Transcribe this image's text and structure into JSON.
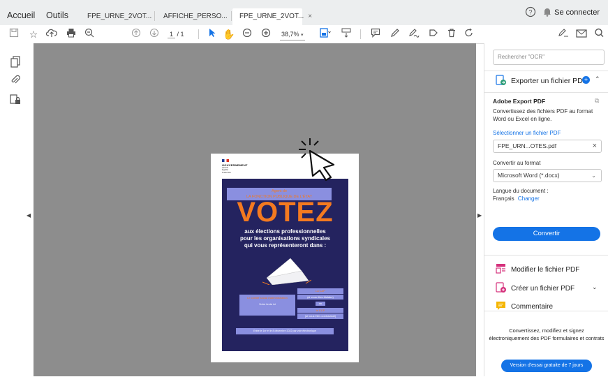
{
  "nav": {
    "home": "Accueil",
    "tools": "Outils"
  },
  "tabs": [
    {
      "label": "FPE_URNE_2VOT..."
    },
    {
      "label": "AFFICHE_PERSO..."
    },
    {
      "label": "FPE_URNE_2VOT...",
      "close": "×"
    }
  ],
  "signin": "Se connecter",
  "toolbar": {
    "page_current": "1",
    "page_total": "/ 1",
    "zoom": "38,7%"
  },
  "poster": {
    "gov_line1": "GOUVERNEMENT",
    "gov_line2": "Liberté",
    "gov_line3": "Égalité",
    "gov_line4": "Fraternité",
    "banner_line1": "Agent de",
    "banner_line2": "LA FONCTION PUBLIQUE DE L'ÉTAT",
    "headline": "VOTEZ",
    "sub1": "aux élections professionnelles",
    "sub2": "pour les organisations syndicales",
    "sub3": "qui vous représenteront dans :",
    "box_left_title": "Le comité social d'administration",
    "box_left_body": "Votre texte ici",
    "cap_title": "La CAP",
    "cap_body": "(si vous êtes titulaire)",
    "ou": "ou",
    "ccp_title": "la CCP",
    "ccp_body": "(si vous êtes contractuel)",
    "footer": "Entre le 1er et le 8 décembre 2022 par voie électronique"
  },
  "panel": {
    "search_placeholder": "Rechercher \"OCR\"",
    "export_label": "Exporter un fichier PDF",
    "section_title": "Adobe Export PDF",
    "description": "Convertissez des fichiers PDF au format Word ou Excel en ligne.",
    "select_file": "Sélectionner un fichier PDF",
    "file_name": "FPE_URN...OTES.pdf",
    "convert_to": "Convertir au format",
    "format_value": "Microsoft Word (*.docx)",
    "language_label": "Langue du document :",
    "language_value": "Français",
    "change": "Changer",
    "convert_button": "Convertir",
    "tools": [
      {
        "label": "Modifier le fichier PDF"
      },
      {
        "label": "Créer un fichier PDF"
      },
      {
        "label": "Commentaire"
      }
    ],
    "promo": "Convertissez, modifiez et signez électroniquement des PDF formulaires et contrats",
    "trial_button": "Version d'essai gratuite de 7 jours"
  },
  "colors": {
    "accent": "#1473e6",
    "poster_bg": "#24235f",
    "poster_orange": "#f47a20",
    "box_blue": "#8a8fe0"
  }
}
